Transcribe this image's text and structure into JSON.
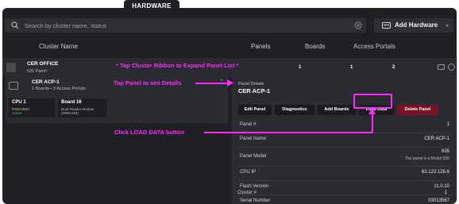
{
  "tabs": {
    "active": "HARDWARE"
  },
  "search": {
    "placeholder": "Search by cluster name, status"
  },
  "add_hardware": {
    "label": "Add Hardware"
  },
  "table": {
    "headers": [
      "Cluster Name",
      "Panels",
      "Boards",
      "Access Portals"
    ]
  },
  "cluster": {
    "name": "CER OFFICE",
    "sub": "635 Panel",
    "panels": "1",
    "boards": "1",
    "portals": "2"
  },
  "panel": {
    "name": "CER ACP-1",
    "sub": "1 Boards • 2 Access Portals",
    "boxes": [
      {
        "title": "CPU 1",
        "l1": "#03013567",
        "l2": "Active"
      },
      {
        "title": "Board 16",
        "l1": "Dual Reader Module",
        "l2": "(DRM 634)"
      }
    ]
  },
  "details": {
    "section": "Panel Details",
    "title": "CER ACP-1",
    "buttons": [
      "Edit Panel",
      "Diagnostics",
      "Add Boards",
      "Load Data",
      "Delete Panel"
    ],
    "rows": [
      {
        "k": "Panel #",
        "v": "1"
      },
      {
        "k": "Panel Name",
        "v": "CER ACP-1"
      },
      {
        "k": "Panel Model",
        "v": "635",
        "v2": "The panel is a Model 635"
      },
      {
        "k": "CPU IP",
        "v": "63.122.126.6"
      },
      {
        "k": "Flash Version",
        "v": "11.0.10"
      },
      {
        "k": "Serial Number",
        "v": "03013567"
      },
      {
        "k": "Cluster #",
        "v": "1"
      }
    ]
  },
  "annotations": {
    "a1": "* Tap Cluster Ribbon to Expand Panel List *",
    "a2": "Tap Panel to see Details",
    "a3": "Click LOAD DATA button"
  },
  "colors": {
    "accent": "#ff29ff",
    "danger": "#7a1226",
    "active": "#3fbf5f"
  }
}
